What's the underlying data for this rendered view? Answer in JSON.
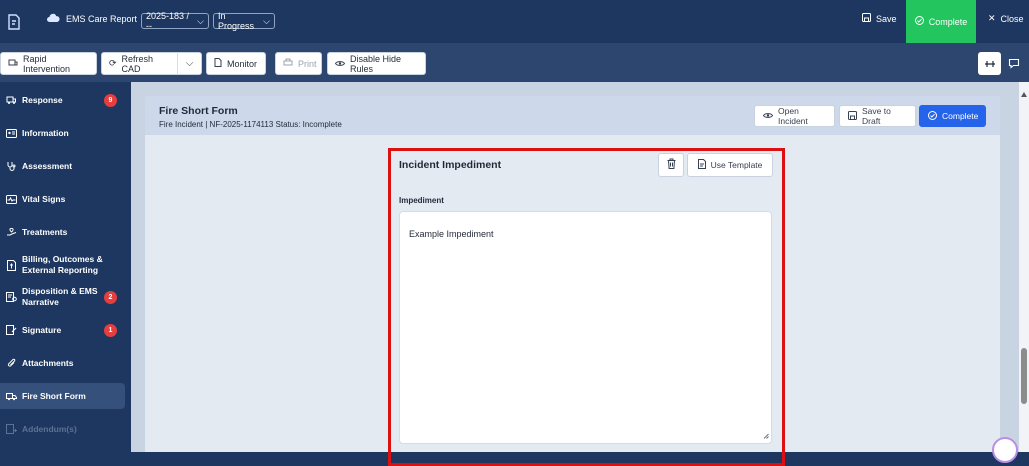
{
  "topbar": {
    "app_title": "EMS Care Report",
    "incident_select": "2025-183 / --",
    "status_select": "In Progress",
    "save_label": "Save",
    "complete_label": "Complete",
    "close_label": "Close"
  },
  "toolbar": {
    "rapid_intervention": "Rapid Intervention",
    "refresh_cad": "Refresh CAD",
    "monitor": "Monitor",
    "print": "Print",
    "disable_hide_rules": "Disable Hide Rules"
  },
  "sidebar": {
    "items": [
      {
        "label": "Response",
        "badge": "9",
        "icon": "ambulance-icon"
      },
      {
        "label": "Information",
        "badge": "",
        "icon": "id-card-icon"
      },
      {
        "label": "Assessment",
        "badge": "",
        "icon": "stethoscope-icon"
      },
      {
        "label": "Vital Signs",
        "badge": "",
        "icon": "heartbeat-icon"
      },
      {
        "label": "Treatments",
        "badge": "",
        "icon": "hand-heart-icon"
      },
      {
        "label": "Billing, Outcomes & External Reporting",
        "badge": "",
        "icon": "billing-icon"
      },
      {
        "label": "Disposition & EMS Narrative",
        "badge": "2",
        "icon": "narrative-icon"
      },
      {
        "label": "Signature",
        "badge": "1",
        "icon": "signature-icon"
      },
      {
        "label": "Attachments",
        "badge": "",
        "icon": "paperclip-icon"
      },
      {
        "label": "Fire Short Form",
        "badge": "",
        "icon": "fire-truck-icon"
      },
      {
        "label": "Addendum(s)",
        "badge": "",
        "icon": "addendum-icon"
      }
    ]
  },
  "form": {
    "title": "Fire Short Form",
    "subtitle": "Fire Incident | NF-2025-1174113 Status: Incomplete",
    "open_incident": "Open Incident",
    "save_to_draft": "Save to Draft",
    "complete": "Complete"
  },
  "section": {
    "title": "Incident Impediment",
    "use_template": "Use Template",
    "field_label": "Impediment",
    "field_value": "Example Impediment"
  },
  "colors": {
    "navy": "#1e3760",
    "toolbar": "#2d4670",
    "complete_green": "#22c55e",
    "primary_blue": "#2563eb",
    "badge_red": "#e53e3e",
    "highlight_red": "#dc1010"
  }
}
